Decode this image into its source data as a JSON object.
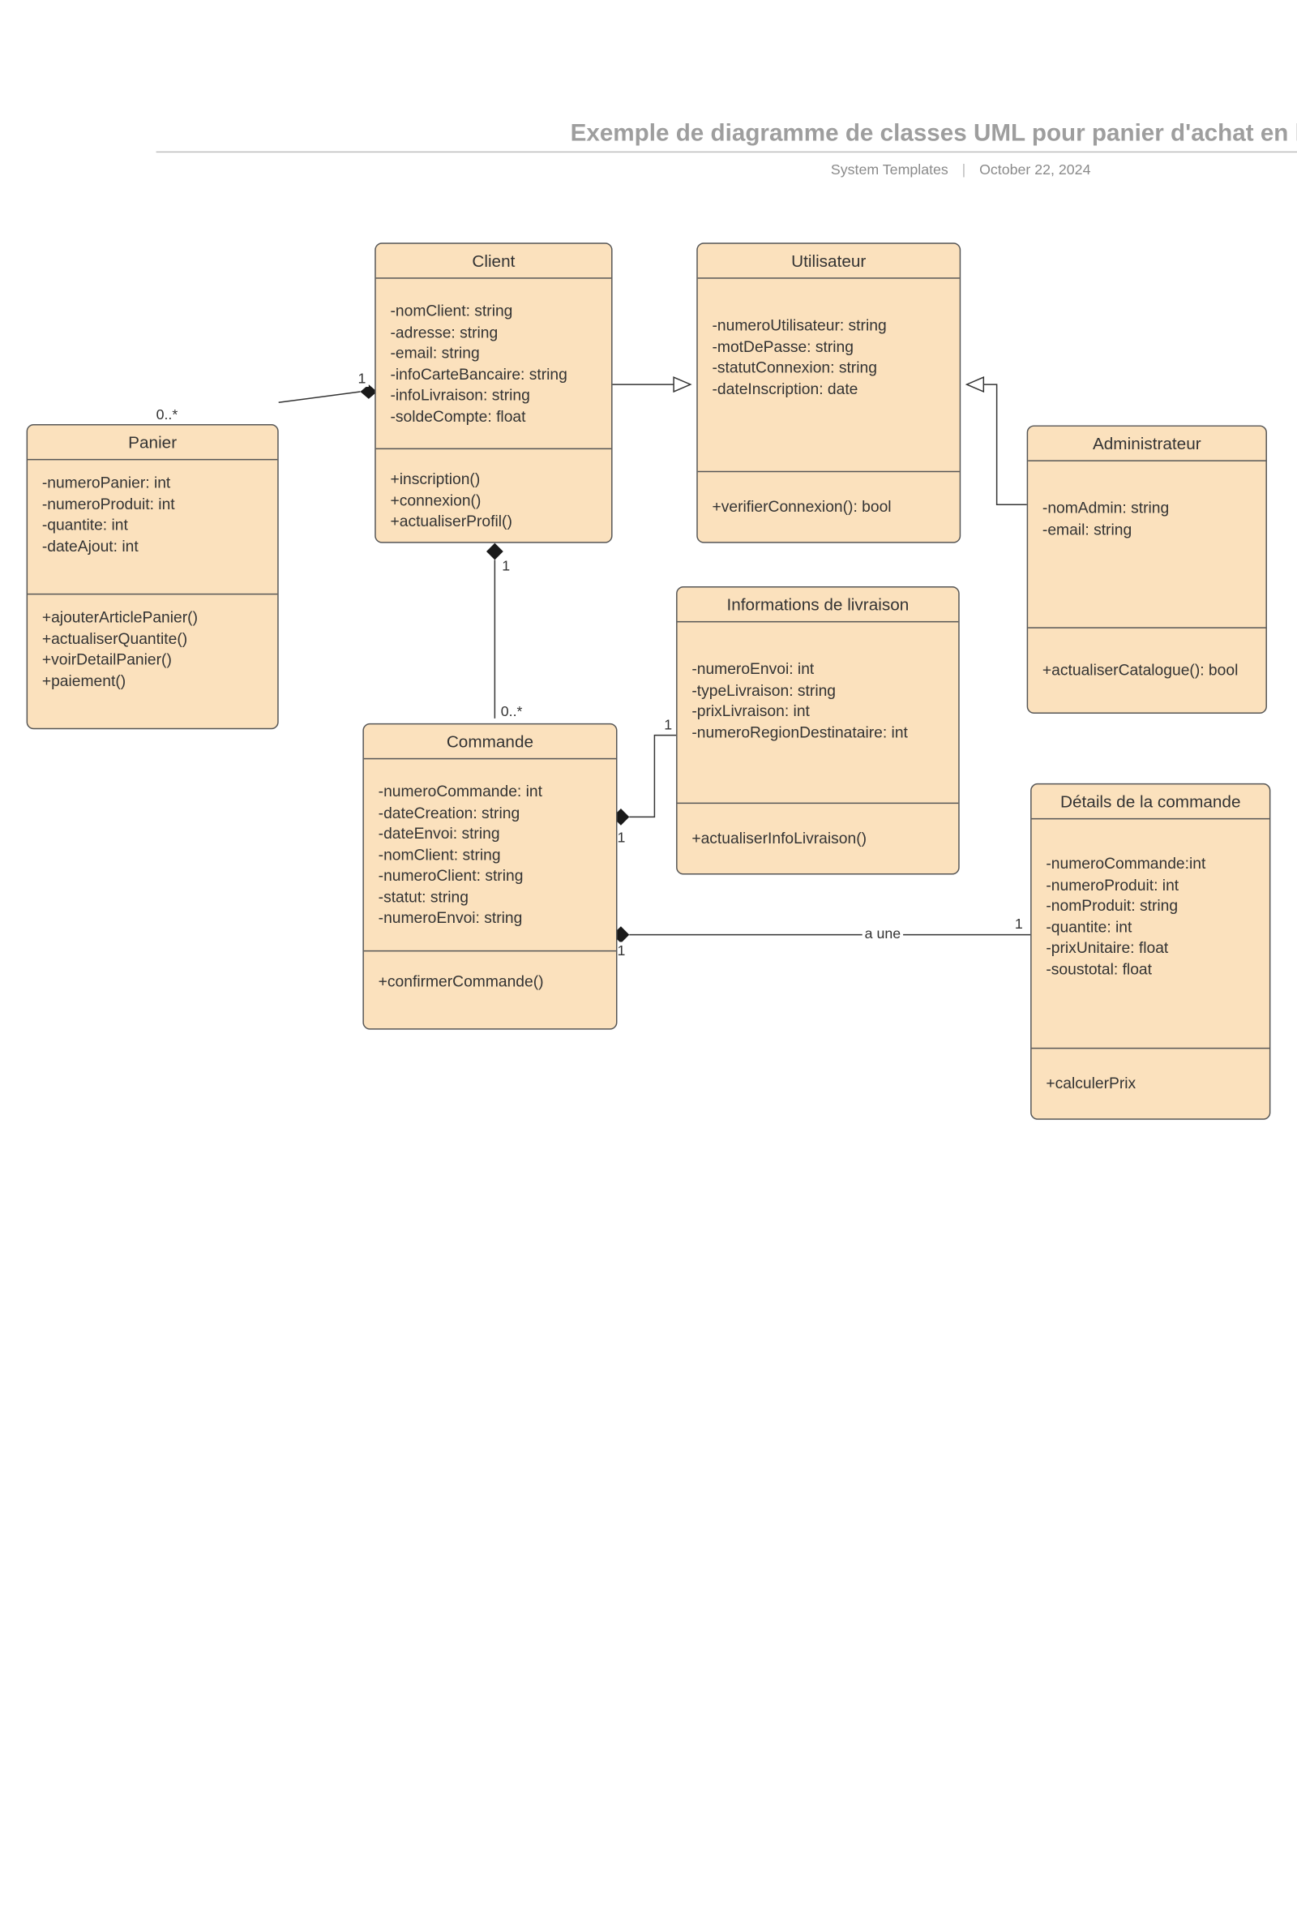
{
  "header": {
    "title": "Exemple de diagramme de classes UML pour panier d'achat en ligne",
    "subtitle_left": "System Templates",
    "subtitle_right": "October 22, 2024"
  },
  "classes": {
    "panier": {
      "name": "Panier",
      "attributes": [
        "-numeroPanier: int",
        "-numeroProduit: int",
        "-quantite: int",
        "-dateAjout: int"
      ],
      "operations": [
        "+ajouterArticlePanier()",
        "+actualiserQuantite()",
        "+voirDetailPanier()",
        "+paiement()"
      ]
    },
    "client": {
      "name": "Client",
      "attributes": [
        "-nomClient: string",
        "-adresse: string",
        "-email: string",
        "-infoCarteBancaire: string",
        "-infoLivraison: string",
        "-soldeCompte: float"
      ],
      "operations": [
        "+inscription()",
        "+connexion()",
        "+actualiserProfil()"
      ]
    },
    "utilisateur": {
      "name": "Utilisateur",
      "attributes": [
        "-numeroUtilisateur: string",
        "-motDePasse: string",
        "-statutConnexion: string",
        "-dateInscription: date"
      ],
      "operations": [
        "+verifierConnexion(): bool"
      ]
    },
    "administrateur": {
      "name": "Administrateur",
      "attributes": [
        "-nomAdmin: string",
        "-email: string"
      ],
      "operations": [
        "+actualiserCatalogue(): bool"
      ]
    },
    "commande": {
      "name": "Commande",
      "attributes": [
        "-numeroCommande: int",
        "-dateCreation: string",
        "-dateEnvoi: string",
        "-nomClient: string",
        "-numeroClient: string",
        "-statut: string",
        "-numeroEnvoi: string"
      ],
      "operations": [
        "+confirmerCommande()"
      ]
    },
    "livraison": {
      "name": "Informations de livraison",
      "attributes": [
        "-numeroEnvoi: int",
        "-typeLivraison: string",
        "-prixLivraison: int",
        "-numeroRegionDestinataire: int"
      ],
      "operations": [
        "+actualiserInfoLivraison()"
      ]
    },
    "details": {
      "name": "Détails de la commande",
      "attributes": [
        "-numeroCommande:int",
        "-numeroProduit: int",
        "-nomProduit: string",
        "-quantite: int",
        "-prixUnitaire: float",
        "-soustotal: float"
      ],
      "operations": [
        "+calculerPrix"
      ]
    }
  },
  "relations": {
    "panier_client": {
      "mult_near_panier": "0..*",
      "mult_near_client": "1"
    },
    "client_utilisateur_generalization": true,
    "admin_utilisateur_generalization": true,
    "client_commande": {
      "mult_near_client": "1",
      "mult_near_commande": "0..*"
    },
    "commande_livraison": {
      "mult_near_commande": "1",
      "mult_near_livraison": "1"
    },
    "commande_details": {
      "label": "a une",
      "mult_near_commande": "1",
      "mult_near_details": "1"
    }
  }
}
